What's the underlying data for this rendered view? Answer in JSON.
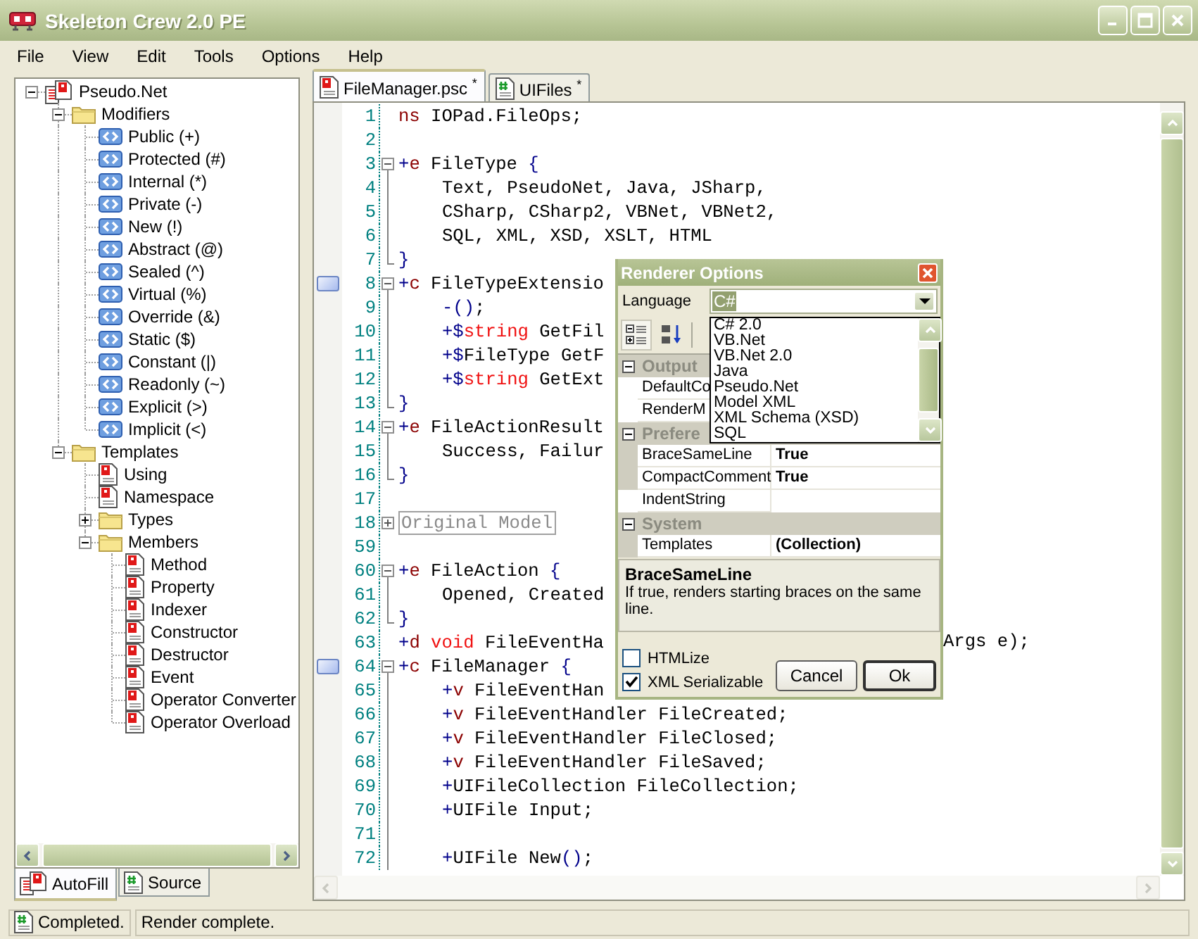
{
  "window": {
    "title": "Skeleton Crew 2.0 PE"
  },
  "menu": [
    "File",
    "View",
    "Edit",
    "Tools",
    "Options",
    "Help"
  ],
  "tree": [
    {
      "label": "Pseudo.Net",
      "kind": "project",
      "expanded": true,
      "children": [
        {
          "label": "Modifiers",
          "kind": "folder",
          "expanded": true,
          "children": [
            {
              "label": "Public (+)",
              "kind": "modifier"
            },
            {
              "label": "Protected (#)",
              "kind": "modifier"
            },
            {
              "label": "Internal (*)",
              "kind": "modifier"
            },
            {
              "label": "Private (-)",
              "kind": "modifier"
            },
            {
              "label": "New (!)",
              "kind": "modifier"
            },
            {
              "label": "Abstract (@)",
              "kind": "modifier"
            },
            {
              "label": "Sealed (^)",
              "kind": "modifier"
            },
            {
              "label": "Virtual (%)",
              "kind": "modifier"
            },
            {
              "label": "Override (&)",
              "kind": "modifier"
            },
            {
              "label": "Static ($)",
              "kind": "modifier"
            },
            {
              "label": "Constant (|)",
              "kind": "modifier"
            },
            {
              "label": "Readonly (~)",
              "kind": "modifier"
            },
            {
              "label": "Explicit (>)",
              "kind": "modifier"
            },
            {
              "label": "Implicit (<)",
              "kind": "modifier"
            }
          ]
        },
        {
          "label": "Templates",
          "kind": "folder",
          "expanded": true,
          "children": [
            {
              "label": "Using",
              "kind": "template"
            },
            {
              "label": "Namespace",
              "kind": "template"
            },
            {
              "label": "Types",
              "kind": "folder",
              "expanded": false
            },
            {
              "label": "Members",
              "kind": "folder",
              "expanded": true,
              "children": [
                {
                  "label": "Method",
                  "kind": "template"
                },
                {
                  "label": "Property",
                  "kind": "template"
                },
                {
                  "label": "Indexer",
                  "kind": "template"
                },
                {
                  "label": "Constructor",
                  "kind": "template"
                },
                {
                  "label": "Destructor",
                  "kind": "template"
                },
                {
                  "label": "Event",
                  "kind": "template"
                },
                {
                  "label": "Operator Converter",
                  "kind": "template"
                },
                {
                  "label": "Operator Overload",
                  "kind": "template"
                }
              ]
            }
          ]
        }
      ]
    }
  ],
  "left_tabs": [
    {
      "label": "AutoFill",
      "kind": "project",
      "selected": true
    },
    {
      "label": "Source",
      "kind": "source",
      "selected": false
    }
  ],
  "editor_tabs": [
    {
      "label": "FileManager.psc $^{*}$",
      "kind": "pseudo",
      "selected": true
    },
    {
      "label": "UIFiles $^{*}$",
      "kind": "source",
      "selected": false
    }
  ],
  "code_lines": [
    {
      "number": "1",
      "kind": "none",
      "bookmarked": false,
      "indented": false,
      "tokens": [
        {
          "text": "ns",
          "kind": "keyword"
        },
        {
          "text": " IOPad.FileOps;",
          "kind": "plain"
        }
      ]
    },
    {
      "number": "2",
      "kind": "none",
      "bookmarked": false
    },
    {
      "number": "3",
      "kind": "start",
      "bookmarked": false,
      "indented": false,
      "tokens": [
        {
          "text": "+",
          "kind": "symbol"
        },
        {
          "text": "e",
          "kind": "keyword"
        },
        {
          "text": " FileType ",
          "kind": "plain"
        },
        {
          "text": "{",
          "kind": "symbol"
        }
      ]
    },
    {
      "number": "4",
      "kind": "body",
      "bookmarked": false,
      "indented": true,
      "tokens": [
        {
          "text": "Text, PseudoNet, Java, JSharp,",
          "kind": "plain"
        }
      ]
    },
    {
      "number": "5",
      "kind": "body",
      "bookmarked": false,
      "indented": true,
      "tokens": [
        {
          "text": "CSharp, CSharp2, VBNet, VBNet2,",
          "kind": "plain"
        }
      ]
    },
    {
      "number": "6",
      "kind": "body",
      "bookmarked": false,
      "indented": true,
      "tokens": [
        {
          "text": "SQL, XML, XSD, XSLT, HTML",
          "kind": "plain"
        }
      ]
    },
    {
      "number": "7",
      "kind": "end",
      "bookmarked": false,
      "indented": false,
      "tokens": [
        {
          "text": "}",
          "kind": "symbol"
        }
      ]
    },
    {
      "number": "8",
      "kind": "start",
      "bookmarked": true,
      "indented": false,
      "tokens": [
        {
          "text": "+",
          "kind": "symbol"
        },
        {
          "text": "c",
          "kind": "keyword"
        },
        {
          "text": " FileTypeExtensio",
          "kind": "plain"
        }
      ]
    },
    {
      "number": "9",
      "kind": "body",
      "bookmarked": false,
      "indented": true,
      "tokens": [
        {
          "text": "-()",
          "kind": "symbol"
        },
        {
          "text": ";",
          "kind": "plain"
        }
      ]
    },
    {
      "number": "10",
      "kind": "body",
      "bookmarked": false,
      "indented": true,
      "tokens": [
        {
          "text": "+$",
          "kind": "symbol"
        },
        {
          "text": "string",
          "kind": "type"
        },
        {
          "text": " GetFil",
          "kind": "plain"
        }
      ]
    },
    {
      "number": "11",
      "kind": "body",
      "bookmarked": false,
      "indented": true,
      "tokens": [
        {
          "text": "+$",
          "kind": "symbol"
        },
        {
          "text": "FileType GetF",
          "kind": "plain"
        }
      ]
    },
    {
      "number": "12",
      "kind": "body",
      "bookmarked": false,
      "indented": true,
      "tokens": [
        {
          "text": "+$",
          "kind": "symbol"
        },
        {
          "text": "string",
          "kind": "type"
        },
        {
          "text": " GetExt",
          "kind": "plain"
        }
      ]
    },
    {
      "number": "13",
      "kind": "end",
      "bookmarked": false,
      "indented": false,
      "tokens": [
        {
          "text": "}",
          "kind": "symbol"
        }
      ]
    },
    {
      "number": "14",
      "kind": "start",
      "bookmarked": false,
      "indented": false,
      "tokens": [
        {
          "text": "+",
          "kind": "symbol"
        },
        {
          "text": "e",
          "kind": "keyword"
        },
        {
          "text": " FileActionResult",
          "kind": "plain"
        }
      ]
    },
    {
      "number": "15",
      "kind": "body",
      "bookmarked": false,
      "indented": true,
      "tokens": [
        {
          "text": "Success, Failur",
          "kind": "plain"
        }
      ]
    },
    {
      "number": "16",
      "kind": "end",
      "bookmarked": false,
      "indented": false,
      "tokens": [
        {
          "text": "}",
          "kind": "symbol"
        }
      ]
    },
    {
      "number": "17",
      "kind": "none",
      "bookmarked": false
    },
    {
      "number": "18",
      "kind": "collapsed",
      "bookmarked": false,
      "indented": false,
      "tokens": [
        {
          "text": "Original Model",
          "kind": "region"
        }
      ]
    },
    {
      "number": "59",
      "kind": "none",
      "bookmarked": false
    },
    {
      "number": "60",
      "kind": "start",
      "bookmarked": false,
      "indented": false,
      "tokens": [
        {
          "text": "+",
          "kind": "symbol"
        },
        {
          "text": "e",
          "kind": "keyword"
        },
        {
          "text": " FileAction ",
          "kind": "plain"
        },
        {
          "text": "{",
          "kind": "symbol"
        }
      ]
    },
    {
      "number": "61",
      "kind": "body",
      "bookmarked": false,
      "indented": true,
      "tokens": [
        {
          "text": "Opened, Created",
          "kind": "plain"
        }
      ]
    },
    {
      "number": "62",
      "kind": "end",
      "bookmarked": false,
      "indented": false,
      "tokens": [
        {
          "text": "}",
          "kind": "symbol"
        }
      ]
    },
    {
      "number": "63",
      "kind": "none",
      "bookmarked": false,
      "indented": false,
      "tokens": [
        {
          "text": "+",
          "kind": "symbol"
        },
        {
          "text": "d",
          "kind": "keyword"
        },
        {
          "text": " void",
          "kind": "type"
        },
        {
          "text": " FileEventHa",
          "kind": "plain"
        }
      ],
      "after_dialog": "Args e);"
    },
    {
      "number": "64",
      "kind": "start",
      "bookmarked": true,
      "indented": false,
      "tokens": [
        {
          "text": "+",
          "kind": "symbol"
        },
        {
          "text": "c",
          "kind": "keyword"
        },
        {
          "text": " FileManager ",
          "kind": "plain"
        },
        {
          "text": "{",
          "kind": "symbol"
        }
      ]
    },
    {
      "number": "65",
      "kind": "body",
      "bookmarked": false,
      "indented": true,
      "tokens": [
        {
          "text": "+",
          "kind": "symbol"
        },
        {
          "text": "v",
          "kind": "keyword"
        },
        {
          "text": " FileEventHan",
          "kind": "plain"
        }
      ]
    },
    {
      "number": "66",
      "kind": "body",
      "bookmarked": false,
      "indented": true,
      "tokens": [
        {
          "text": "+",
          "kind": "symbol"
        },
        {
          "text": "v",
          "kind": "keyword"
        },
        {
          "text": " FileEventHandler FileCreated;",
          "kind": "plain"
        }
      ]
    },
    {
      "number": "67",
      "kind": "body",
      "bookmarked": false,
      "indented": true,
      "tokens": [
        {
          "text": "+",
          "kind": "symbol"
        },
        {
          "text": "v",
          "kind": "keyword"
        },
        {
          "text": " FileEventHandler FileClosed;",
          "kind": "plain"
        }
      ]
    },
    {
      "number": "68",
      "kind": "body",
      "bookmarked": false,
      "indented": true,
      "tokens": [
        {
          "text": "+",
          "kind": "symbol"
        },
        {
          "text": "v",
          "kind": "keyword"
        },
        {
          "text": " FileEventHandler FileSaved;",
          "kind": "plain"
        }
      ]
    },
    {
      "number": "69",
      "kind": "body",
      "bookmarked": false,
      "indented": true,
      "tokens": [
        {
          "text": "+",
          "kind": "symbol"
        },
        {
          "text": "UIFileCollection FileCollection;",
          "kind": "plain"
        }
      ]
    },
    {
      "number": "70",
      "kind": "body",
      "bookmarked": false,
      "indented": true,
      "tokens": [
        {
          "text": "+",
          "kind": "symbol"
        },
        {
          "text": "UIFile Input;",
          "kind": "plain"
        }
      ]
    },
    {
      "number": "71",
      "kind": "body",
      "bookmarked": false
    },
    {
      "number": "72",
      "kind": "body",
      "bookmarked": false,
      "indented": true,
      "tokens": [
        {
          "text": "+",
          "kind": "symbol"
        },
        {
          "text": "UIFile New",
          "kind": "plain"
        },
        {
          "text": "()",
          "kind": "symbol"
        },
        {
          "text": ";",
          "kind": "plain"
        }
      ]
    }
  ],
  "dialog": {
    "title": "Renderer Options",
    "language": {
      "label": "Language",
      "value": "C#",
      "options": [
        {
          "label": "C# 2.0",
          "selected": false
        },
        {
          "label": "VB.Net",
          "selected": false
        },
        {
          "label": "VB.Net 2.0",
          "selected": false
        },
        {
          "label": "Java",
          "selected": false
        },
        {
          "label": "Pseudo.Net",
          "selected": false
        },
        {
          "label": "Model XML",
          "selected": false
        },
        {
          "label": "XML Schema (XSD)",
          "selected": false
        },
        {
          "label": "SQL",
          "selected": false
        }
      ]
    },
    "property_grid": [
      {
        "kind": "category",
        "label": "Output",
        "expanded": true
      },
      {
        "kind": "property",
        "name": "DefaultCo"
      },
      {
        "kind": "property",
        "name": "RenderM"
      },
      {
        "kind": "category",
        "label": "Prefere",
        "expanded": true
      },
      {
        "kind": "property",
        "name": "BraceSameLine",
        "value": "True"
      },
      {
        "kind": "property",
        "name": "CompactComment",
        "value": "True"
      },
      {
        "kind": "property",
        "name": "IndentString"
      },
      {
        "kind": "category",
        "label": "System",
        "expanded": true
      },
      {
        "kind": "property",
        "name": "Templates",
        "value": "(Collection)"
      }
    ],
    "description": {
      "title": "BraceSameLine",
      "text": "If true, renders starting braces on the same line."
    },
    "options": [
      {
        "label": "HTMLize",
        "checked": false
      },
      {
        "label": "XML Serializable",
        "checked": true
      }
    ],
    "buttons": [
      {
        "label": "Cancel",
        "default": false
      },
      {
        "label": "Ok",
        "default": true
      }
    ]
  },
  "status_bar": [
    {
      "text": "Completed.",
      "kind": "icon"
    },
    {
      "text": "Render complete.",
      "kind": "plain"
    }
  ]
}
